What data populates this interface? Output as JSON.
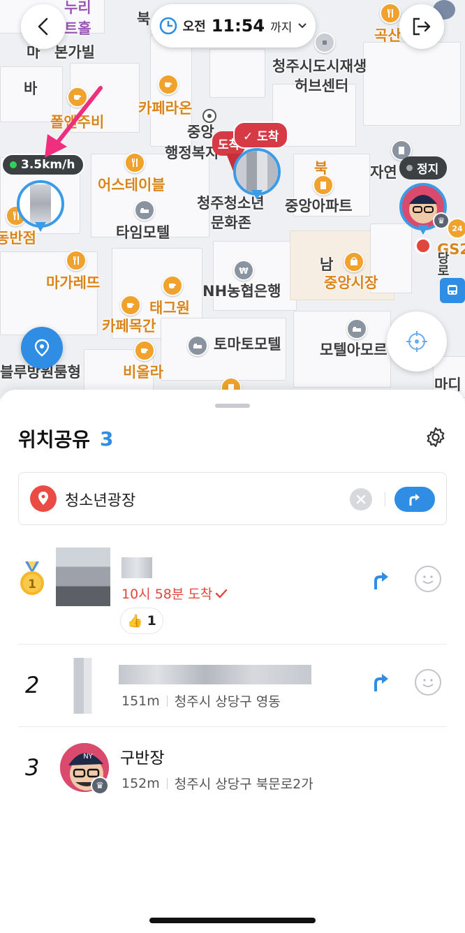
{
  "map": {
    "speed": "3.5km/h",
    "status_stop": "정지",
    "arrive_tag": "도착",
    "arrive_tag_back": "도착",
    "time_chip": {
      "period": "오전",
      "time": "11:54",
      "suffix": "까지"
    },
    "labels": [
      {
        "text": "본가빌",
        "style": "gy"
      },
      {
        "text": "마",
        "style": "gy"
      },
      {
        "text": "바",
        "style": "gy"
      },
      {
        "text": "북",
        "style": "gy"
      },
      {
        "text": "누리",
        "style": "pu"
      },
      {
        "text": "트홀",
        "style": "pu"
      },
      {
        "text": "폴앤주비",
        "style": "or"
      },
      {
        "text": "카페라온",
        "style": "or"
      },
      {
        "text": "중앙",
        "style": "gy"
      },
      {
        "text": "행정복지",
        "style": "gy"
      },
      {
        "text": "청주시도시재생",
        "style": "gy"
      },
      {
        "text": "허브센터",
        "style": "gy"
      },
      {
        "text": "곡산",
        "style": "or"
      },
      {
        "text": "어스테이블",
        "style": "or"
      },
      {
        "text": "자연",
        "style": "gy"
      },
      {
        "text": "북",
        "style": "gy"
      },
      {
        "text": "중앙아파트",
        "style": "gy"
      },
      {
        "text": "청주청소년",
        "style": "gy"
      },
      {
        "text": "문화존",
        "style": "gy"
      },
      {
        "text": "타임모텔",
        "style": "gy"
      },
      {
        "text": "동반점",
        "style": "or"
      },
      {
        "text": "마가레뜨",
        "style": "or"
      },
      {
        "text": "NH농협은행",
        "style": "gy"
      },
      {
        "text": "남",
        "style": "gy"
      },
      {
        "text": "중앙시장",
        "style": "or"
      },
      {
        "text": "태그원",
        "style": "or"
      },
      {
        "text": "카페목간",
        "style": "or"
      },
      {
        "text": "토마토모텔",
        "style": "gy"
      },
      {
        "text": "모텔아모르",
        "style": "gy"
      },
      {
        "text": "블루방원룸형",
        "style": "gy"
      },
      {
        "text": "비올라",
        "style": "or"
      },
      {
        "text": "GS2",
        "style": "or"
      },
      {
        "text": "마디",
        "style": "gy"
      },
      {
        "text": "당로",
        "style": "gy"
      },
      {
        "text": "24",
        "style": "gy"
      }
    ]
  },
  "sheet": {
    "title": "위치공유",
    "count": "3",
    "destination": "청소년광장",
    "members": [
      {
        "rank": "1",
        "name": "",
        "status": "10시 58분 도착",
        "reaction_count": "1"
      },
      {
        "rank": "2",
        "name": "",
        "distance": "151m",
        "address": "청주시 상당구 영동"
      },
      {
        "rank": "3",
        "name": "구반장",
        "distance": "152m",
        "address": "청주시 상당구 북문로2가"
      }
    ]
  },
  "colors": {
    "accent": "#2f8de4",
    "arrived": "#e0463e",
    "brand_red": "#d63a45",
    "place_orange": "#f1a22d"
  }
}
